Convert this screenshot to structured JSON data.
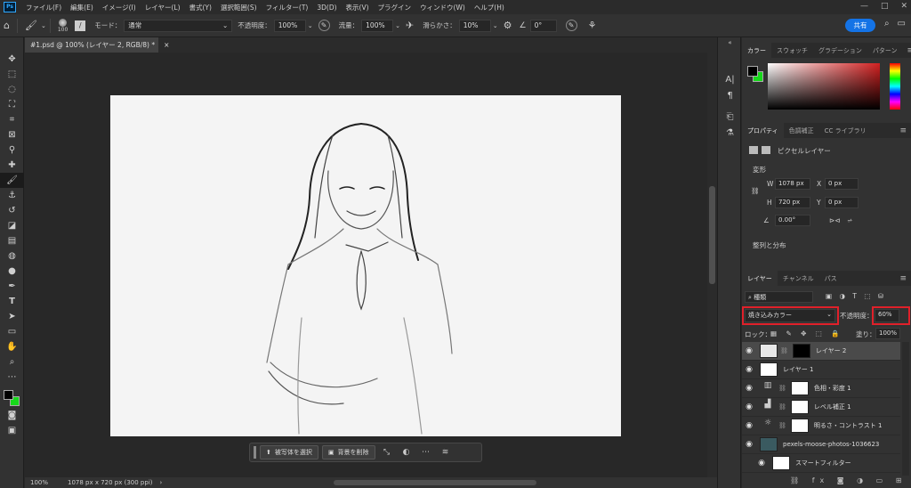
{
  "menubar": {
    "app_badge": "Ps",
    "items": [
      "ファイル(F)",
      "編集(E)",
      "イメージ(I)",
      "レイヤー(L)",
      "書式(Y)",
      "選択範囲(S)",
      "フィルター(T)",
      "3D(D)",
      "表示(V)",
      "プラグイン",
      "ウィンドウ(W)",
      "ヘルプ(H)"
    ],
    "window_controls": [
      "—",
      "□",
      "✕"
    ]
  },
  "options": {
    "brush_size": "100",
    "mode_label": "モード：",
    "mode_value": "通常",
    "opacity_label": "不透明度：",
    "opacity_value": "100%",
    "flow_label": "流量：",
    "flow_value": "100%",
    "smoothing_label": "滑らかさ：",
    "smoothing_value": "10%",
    "angle_value": "0°",
    "share_label": "共有"
  },
  "document": {
    "tab_title": "#1.psd @ 100% (レイヤー 2, RGB/8) *",
    "tab_close": "×",
    "zoom": "100%",
    "dimensions": "1078 px x 720 px (300 ppi)"
  },
  "contextual_bar": {
    "select_subject": "被写体を選択",
    "remove_background": "背景を削除"
  },
  "color_panel": {
    "tabs": [
      "カラー",
      "スウォッチ",
      "グラデーション",
      "パターン"
    ],
    "foreground": "#000000",
    "background": "#16d81a",
    "hue_field_color": "#d22020"
  },
  "properties_panel": {
    "tabs": [
      "プロパティ",
      "色調補正",
      "CC ライブラリ"
    ],
    "layer_type": "ピクセルレイヤー",
    "transform_heading": "変形",
    "w_label": "W",
    "w_value": "1078 px",
    "h_label": "H",
    "h_value": "720 px",
    "x_label": "X",
    "x_value": "0 px",
    "y_label": "Y",
    "y_value": "0 px",
    "angle_value": "0.00°",
    "align_heading": "整列と分布"
  },
  "layers_panel": {
    "tabs": [
      "レイヤー",
      "チャンネル",
      "パス"
    ],
    "filter_kind": "種類",
    "blend_mode": "焼き込みカラー",
    "opacity_label": "不透明度：",
    "opacity_value": "60%",
    "lock_label": "ロック：",
    "fill_label": "塗り：",
    "fill_value": "100%",
    "layers": [
      {
        "name": "レイヤー 2",
        "selected": true
      },
      {
        "name": "レイヤー 1",
        "selected": false
      },
      {
        "name": "色相・彩度 1",
        "selected": false
      },
      {
        "name": "レベル補正 1",
        "selected": false
      },
      {
        "name": "明るさ・コントラスト 1",
        "selected": false
      },
      {
        "name": "pexels-moose-photos-1036623",
        "selected": false
      },
      {
        "name": "スマートフィルター",
        "selected": false
      }
    ]
  },
  "highlight_color": "#e0202a"
}
